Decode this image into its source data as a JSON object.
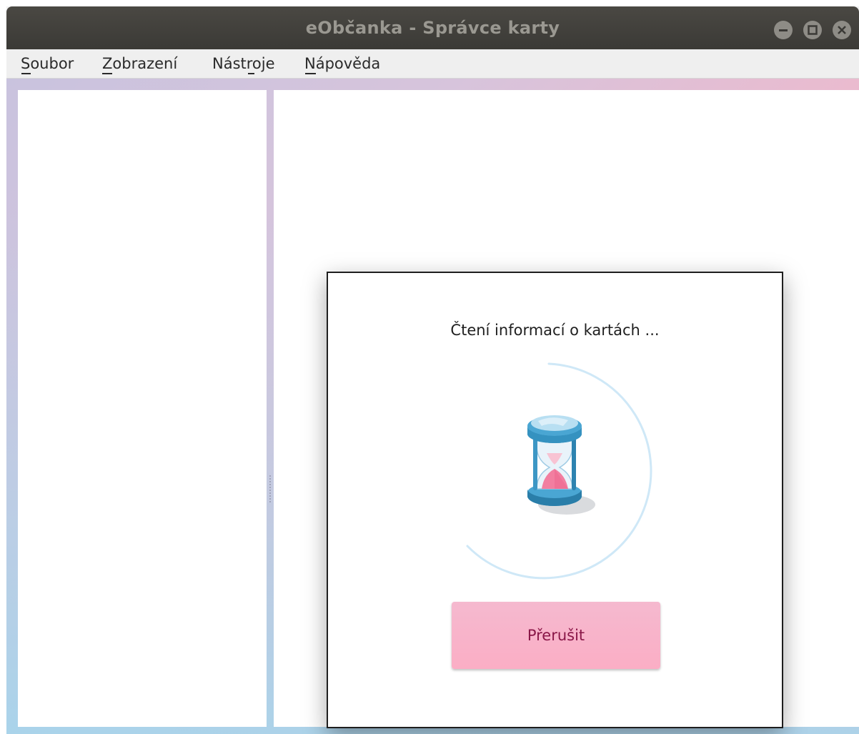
{
  "window": {
    "title": "eObčanka - Správce karty"
  },
  "menu": {
    "items": [
      {
        "label": "Soubor",
        "mnemonic": "S"
      },
      {
        "label": "Zobrazení",
        "mnemonic": "Z"
      },
      {
        "label": "Nástroje",
        "mnemonic": "t"
      },
      {
        "label": "Nápověda",
        "mnemonic": "N"
      }
    ]
  },
  "dialog": {
    "message": "Čtení informací o kartách ...",
    "cancel_label": "Přerušit",
    "icon": "hourglass-icon"
  },
  "colors": {
    "titlebar": "#3b3a36",
    "accent_pink": "#fbaec5",
    "cancel_text": "#8a1748",
    "spinner": "#cfe8f7"
  }
}
